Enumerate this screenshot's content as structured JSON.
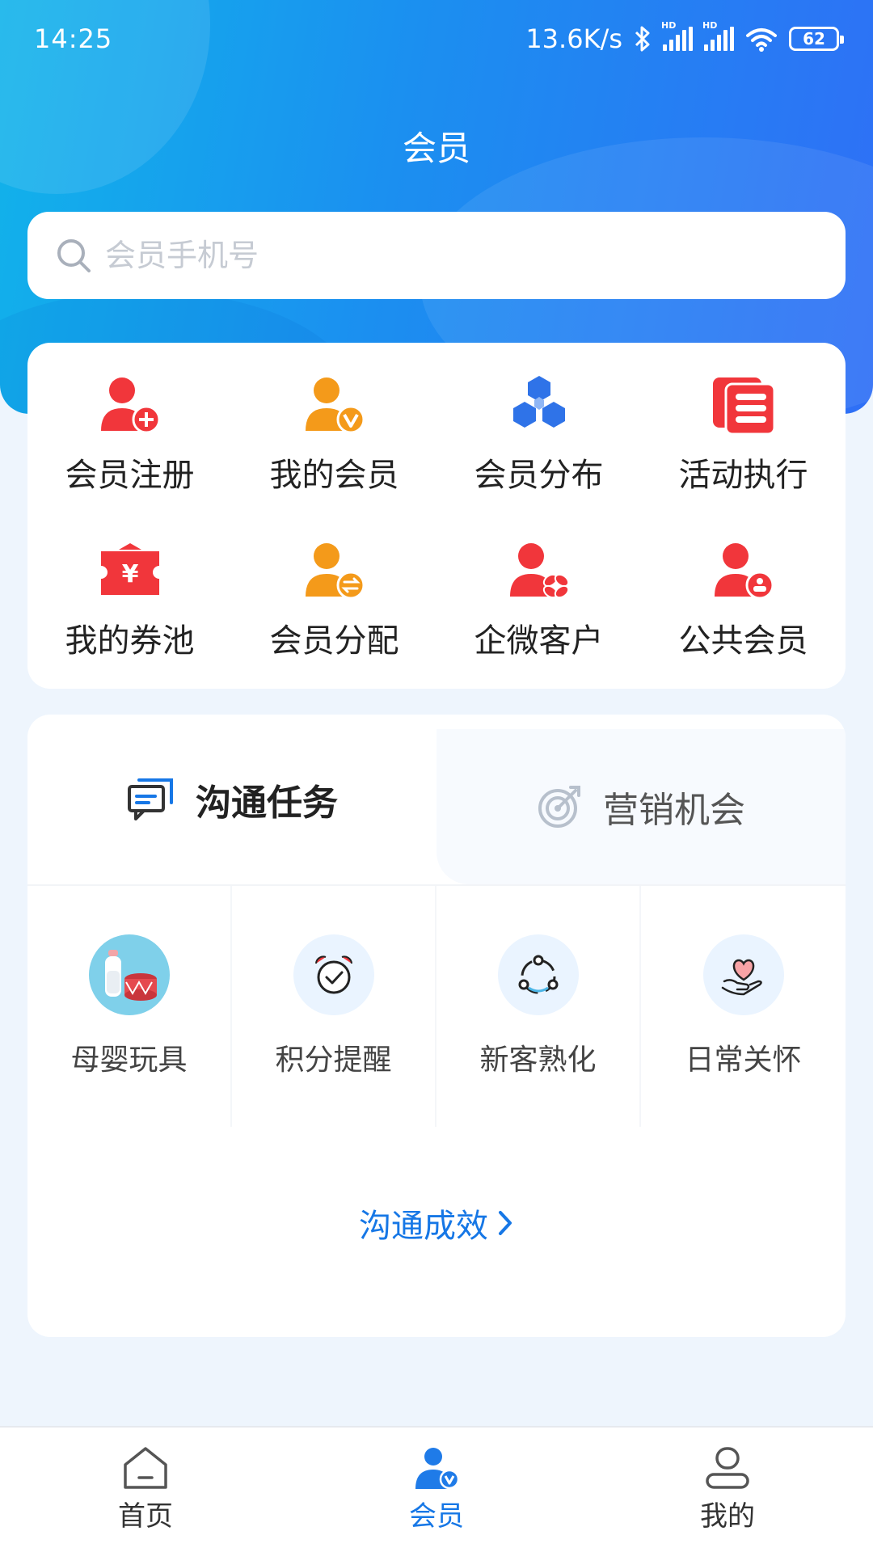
{
  "status_bar": {
    "time": "14:25",
    "speed": "13.6K/s",
    "battery": "62"
  },
  "header": {
    "title": "会员"
  },
  "search": {
    "placeholder": "会员手机号"
  },
  "menu": {
    "items": [
      {
        "label": "会员注册",
        "icon": "person-add-icon",
        "color": "#f1363b"
      },
      {
        "label": "我的会员",
        "icon": "person-check-icon",
        "color": "#f49a1a"
      },
      {
        "label": "会员分布",
        "icon": "hexagon-cluster-icon",
        "color": "#2f73e8"
      },
      {
        "label": "活动执行",
        "icon": "document-stack-icon",
        "color": "#f1363b"
      },
      {
        "label": "我的券池",
        "icon": "coupon-icon",
        "color": "#f1363b"
      },
      {
        "label": "会员分配",
        "icon": "person-exchange-icon",
        "color": "#f49a1a"
      },
      {
        "label": "企微客户",
        "icon": "person-link-icon",
        "color": "#f1363b"
      },
      {
        "label": "公共会员",
        "icon": "person-group-icon",
        "color": "#f1363b"
      }
    ]
  },
  "tasks": {
    "tabs": [
      {
        "label": "沟通任务",
        "icon": "chat-icon",
        "active": true
      },
      {
        "label": "营销机会",
        "icon": "target-icon",
        "active": false
      }
    ],
    "items": [
      {
        "label": "母婴玩具",
        "icon": "baby-toys-icon"
      },
      {
        "label": "积分提醒",
        "icon": "alarm-clock-icon"
      },
      {
        "label": "新客熟化",
        "icon": "cycle-icon"
      },
      {
        "label": "日常关怀",
        "icon": "heart-hand-icon"
      }
    ],
    "effect_link": "沟通成效"
  },
  "bottom_nav": {
    "items": [
      {
        "label": "首页",
        "icon": "home-icon",
        "active": false
      },
      {
        "label": "会员",
        "icon": "member-icon",
        "active": true
      },
      {
        "label": "我的",
        "icon": "profile-icon",
        "active": false
      }
    ]
  },
  "colors": {
    "primary": "#1677e6",
    "red": "#f1363b",
    "orange": "#f49a1a"
  }
}
